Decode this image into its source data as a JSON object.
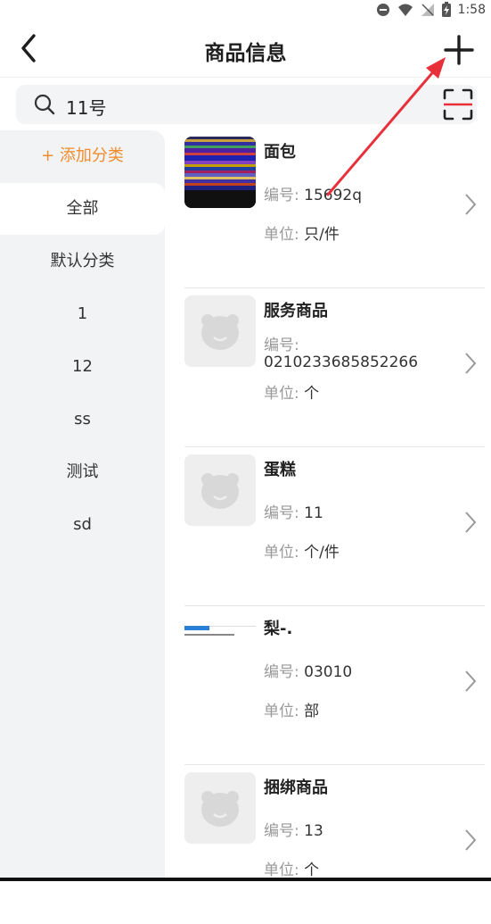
{
  "status": {
    "time": "1:58"
  },
  "header": {
    "title": "商品信息"
  },
  "search": {
    "query": "11号"
  },
  "sidebar": {
    "add_label": "+ 添加分类",
    "items": [
      "全部",
      "默认分类",
      "1",
      "12",
      "ss",
      "测试",
      "sd"
    ],
    "active_index": 0
  },
  "labels": {
    "code": "编号:",
    "unit": "单位:"
  },
  "products": [
    {
      "name": "面包",
      "code": "15692q",
      "unit": "只/件"
    },
    {
      "name": "服务商品",
      "code": "0210233685852266",
      "unit": "个"
    },
    {
      "name": "蛋糕",
      "code": "11",
      "unit": "个/件"
    },
    {
      "name": "梨-.",
      "code": "03010",
      "unit": "部"
    },
    {
      "name": "捆绑商品",
      "code": "13",
      "unit": "个"
    }
  ],
  "colors": {
    "accent": "#f08c2c",
    "arrow": "#e8303a",
    "scan_line": "#e8303a"
  },
  "icons": {
    "back": "chevron-left-icon",
    "add": "plus-icon",
    "search": "search-icon",
    "scan": "scan-icon",
    "row": "chevron-right-icon",
    "placeholder": "bear-placeholder-icon"
  }
}
